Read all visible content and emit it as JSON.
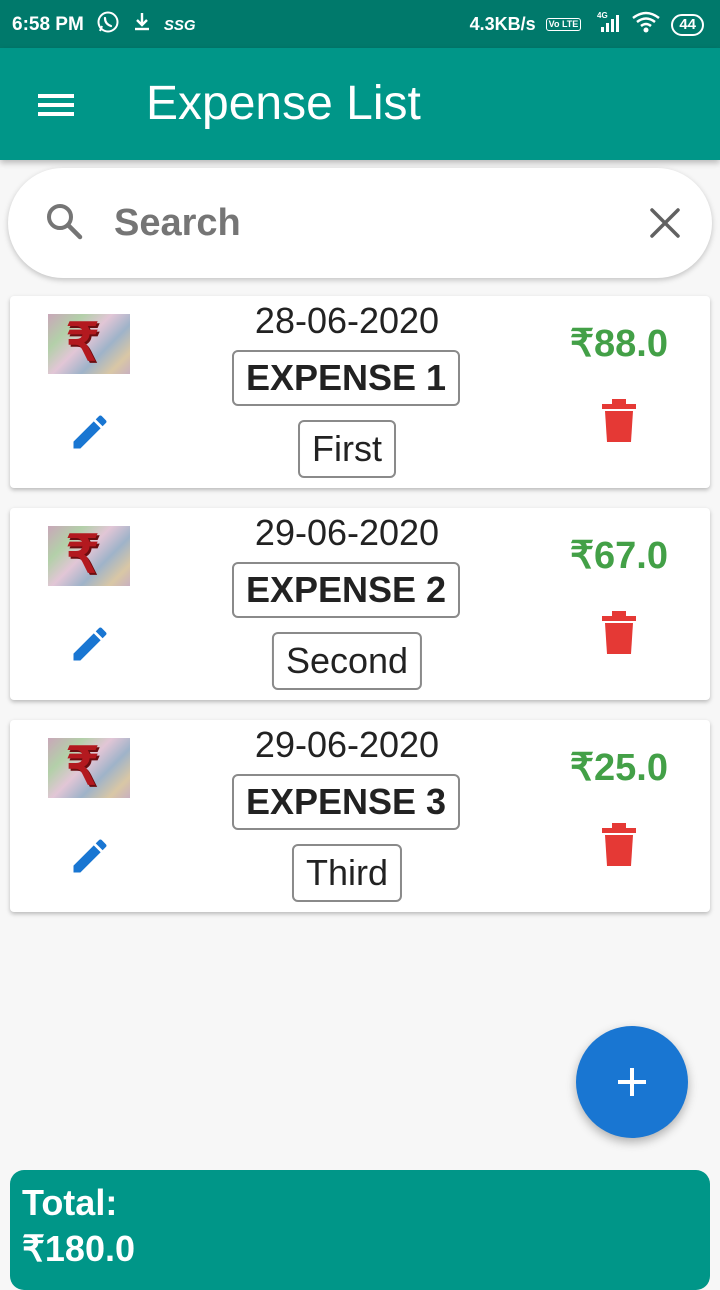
{
  "status_bar": {
    "time": "6:58 PM",
    "carrier": "SSG",
    "network_speed": "4.3KB/s",
    "network_type": "4G",
    "volte": "Vo LTE",
    "battery": "44"
  },
  "app_bar": {
    "title": "Expense List",
    "menu_icon": "hamburger-menu-icon"
  },
  "search": {
    "placeholder": "Search",
    "value": ""
  },
  "expenses": [
    {
      "date": "28-06-2020",
      "name": "EXPENSE 1",
      "description": "First",
      "amount": "₹88.0"
    },
    {
      "date": "29-06-2020",
      "name": "EXPENSE 2",
      "description": "Second",
      "amount": "₹67.0"
    },
    {
      "date": "29-06-2020",
      "name": "EXPENSE 3",
      "description": "Third",
      "amount": "₹25.0"
    }
  ],
  "fab": {
    "icon": "plus-icon"
  },
  "total": {
    "label": "Total:",
    "value": "₹180.0"
  },
  "colors": {
    "primary": "#009688",
    "primary_dark": "#00796b",
    "amount_green": "#43a047",
    "edit_blue": "#1976d2",
    "delete_red": "#e53935",
    "fab_blue": "#1976d2"
  }
}
